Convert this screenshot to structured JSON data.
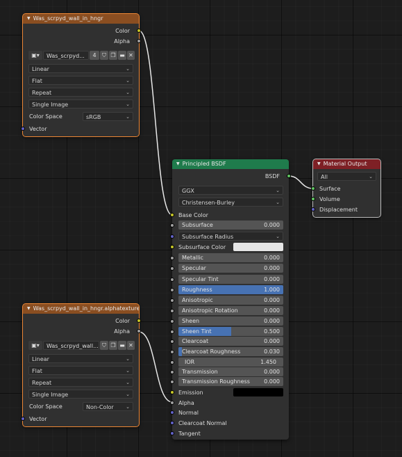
{
  "image_node_1": {
    "title": "Was_scrpyd_wall_in_hngr",
    "outputs": [
      "Color",
      "Alpha"
    ],
    "image_name": "Was_scrpyd...",
    "users": "4",
    "interpolation": "Linear",
    "projection": "Flat",
    "extension": "Repeat",
    "source": "Single Image",
    "color_space_label": "Color Space",
    "color_space": "sRGB",
    "vector_label": "Vector"
  },
  "image_node_2": {
    "title": "Was_scrpyd_wall_in_hngr.alphatexture",
    "outputs": [
      "Color",
      "Alpha"
    ],
    "image_name": "Was_scrpyd_wall...",
    "interpolation": "Linear",
    "projection": "Flat",
    "extension": "Repeat",
    "source": "Single Image",
    "color_space_label": "Color Space",
    "color_space": "Non-Color",
    "vector_label": "Vector"
  },
  "bsdf": {
    "title": "Principled BSDF",
    "output": "BSDF",
    "distribution": "GGX",
    "subsurface_method": "Christensen-Burley",
    "base_color_label": "Base Color",
    "subsurface": {
      "label": "Subsurface",
      "value": "0.000"
    },
    "subsurface_radius": "Subsurface Radius",
    "subsurface_color_label": "Subsurface Color",
    "fields": [
      {
        "label": "Metallic",
        "value": "0.000",
        "fill": 0
      },
      {
        "label": "Specular",
        "value": "0.000",
        "fill": 0
      },
      {
        "label": "Specular Tint",
        "value": "0.000",
        "fill": 0
      },
      {
        "label": "Roughness",
        "value": "1.000",
        "fill": 1
      },
      {
        "label": "Anisotropic",
        "value": "0.000",
        "fill": 0
      },
      {
        "label": "Anisotropic Rotation",
        "value": "0.000",
        "fill": 0
      },
      {
        "label": "Sheen",
        "value": "0.000",
        "fill": 0
      },
      {
        "label": "Sheen Tint",
        "value": "0.500",
        "fill": 0.5
      },
      {
        "label": "Clearcoat",
        "value": "0.000",
        "fill": 0
      },
      {
        "label": "Clearcoat Roughness",
        "value": "0.030",
        "fill": 0.03
      },
      {
        "label": "IOR",
        "value": "1.450",
        "fill": 0
      },
      {
        "label": "Transmission",
        "value": "0.000",
        "fill": 0
      },
      {
        "label": "Transmission Roughness",
        "value": "0.000",
        "fill": 0
      }
    ],
    "emission_label": "Emission",
    "alpha_label": "Alpha",
    "normal_label": "Normal",
    "clearcoat_normal_label": "Clearcoat Normal",
    "tangent_label": "Tangent"
  },
  "material_output": {
    "title": "Material Output",
    "target": "All",
    "inputs": [
      "Surface",
      "Volume",
      "Displacement"
    ]
  },
  "colors": {
    "image_header": "#8a4e21",
    "shader_header": "#1f7b4c",
    "output_header": "#7e2025",
    "slider_fill": "#4772b3",
    "subsurface_color": "#e6e6e6",
    "emission_color": "#000000"
  }
}
